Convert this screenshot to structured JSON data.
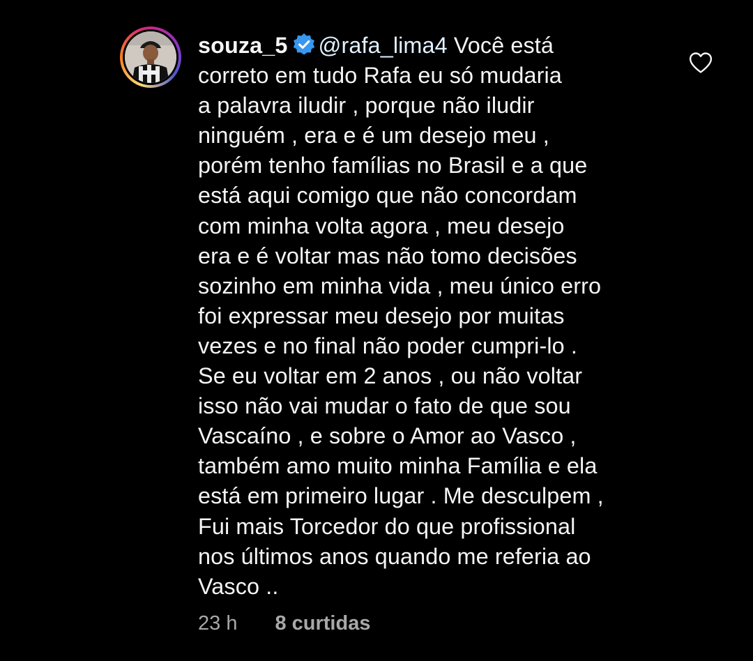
{
  "comment": {
    "username": "souza_5",
    "verified": true,
    "mention": "@rafa_lima4",
    "first_line_rest": "Você está",
    "lines": [
      "correto em tudo Rafa eu só mudaria",
      "a palavra iludir , porque não iludir",
      "ninguém , era e é um desejo meu ,",
      "porém tenho famílias no Brasil e a que",
      "está aqui comigo que não concordam",
      "com minha volta agora , meu desejo",
      "era e é voltar mas não tomo decisões",
      "sozinho em minha vida , meu único erro",
      "foi expressar meu desejo por muitas",
      "vezes e no final não poder cumpri-lo .",
      "Se eu voltar em 2 anos , ou não voltar",
      "isso não vai mudar o fato de que sou",
      "Vascaíno , e sobre o Amor ao Vasco ,",
      "também amo muito minha Família e ela",
      "está em primeiro lugar . Me desculpem ,",
      "Fui mais Torcedor do que profissional",
      "nos últimos anos quando me referia ao",
      "Vasco .."
    ],
    "time_ago": "23 h",
    "likes": "8 curtidas"
  },
  "icons": {
    "verified": "verified-badge-icon",
    "like": "heart-outline-icon"
  },
  "colors": {
    "background": "#000000",
    "text": "#f5f5f5",
    "meta": "#a8a8a8",
    "verified": "#3897f0"
  }
}
